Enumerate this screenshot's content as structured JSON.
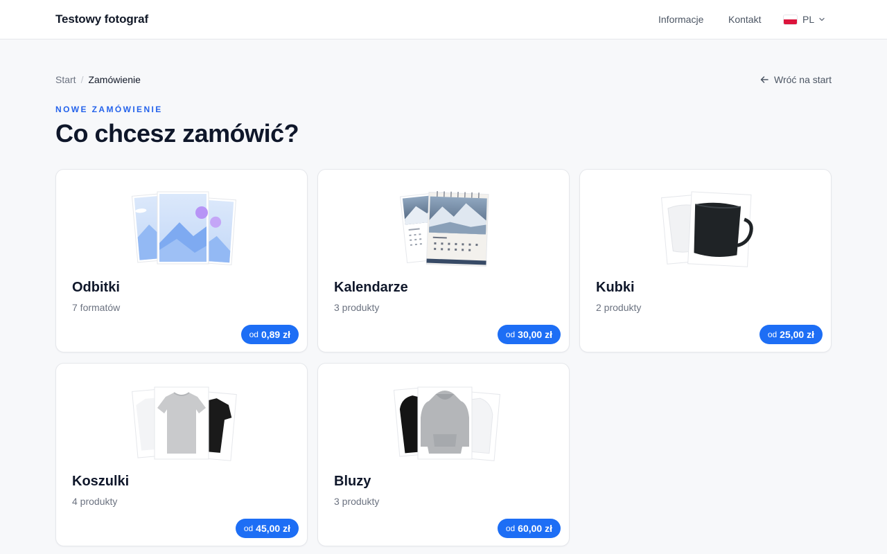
{
  "header": {
    "brand": "Testowy fotograf",
    "nav": [
      "Informacje",
      "Kontakt"
    ],
    "language": "PL"
  },
  "breadcrumb": {
    "start": "Start",
    "separator": "/",
    "current": "Zamówienie"
  },
  "back_link": "Wróć na start",
  "eyebrow": "NOWE ZAMÓWIENIE",
  "title": "Co chcesz zamówić?",
  "products": [
    {
      "name": "Odbitki",
      "count": "7 formatów",
      "price_prefix": "od",
      "price": "0,89 zł",
      "icon": "photo-prints-icon"
    },
    {
      "name": "Kalendarze",
      "count": "3 produkty",
      "price_prefix": "od",
      "price": "30,00 zł",
      "icon": "calendar-icon"
    },
    {
      "name": "Kubki",
      "count": "2 produkty",
      "price_prefix": "od",
      "price": "25,00 zł",
      "icon": "mug-icon"
    },
    {
      "name": "Koszulki",
      "count": "4 produkty",
      "price_prefix": "od",
      "price": "45,00 zł",
      "icon": "tshirt-icon"
    },
    {
      "name": "Bluzy",
      "count": "3 produkty",
      "price_prefix": "od",
      "price": "60,00 zł",
      "icon": "hoodie-icon"
    }
  ],
  "colors": {
    "accent": "#1d6ef5",
    "eyebrow": "#2563eb",
    "background": "#f7f8fa",
    "card": "#ffffff"
  }
}
